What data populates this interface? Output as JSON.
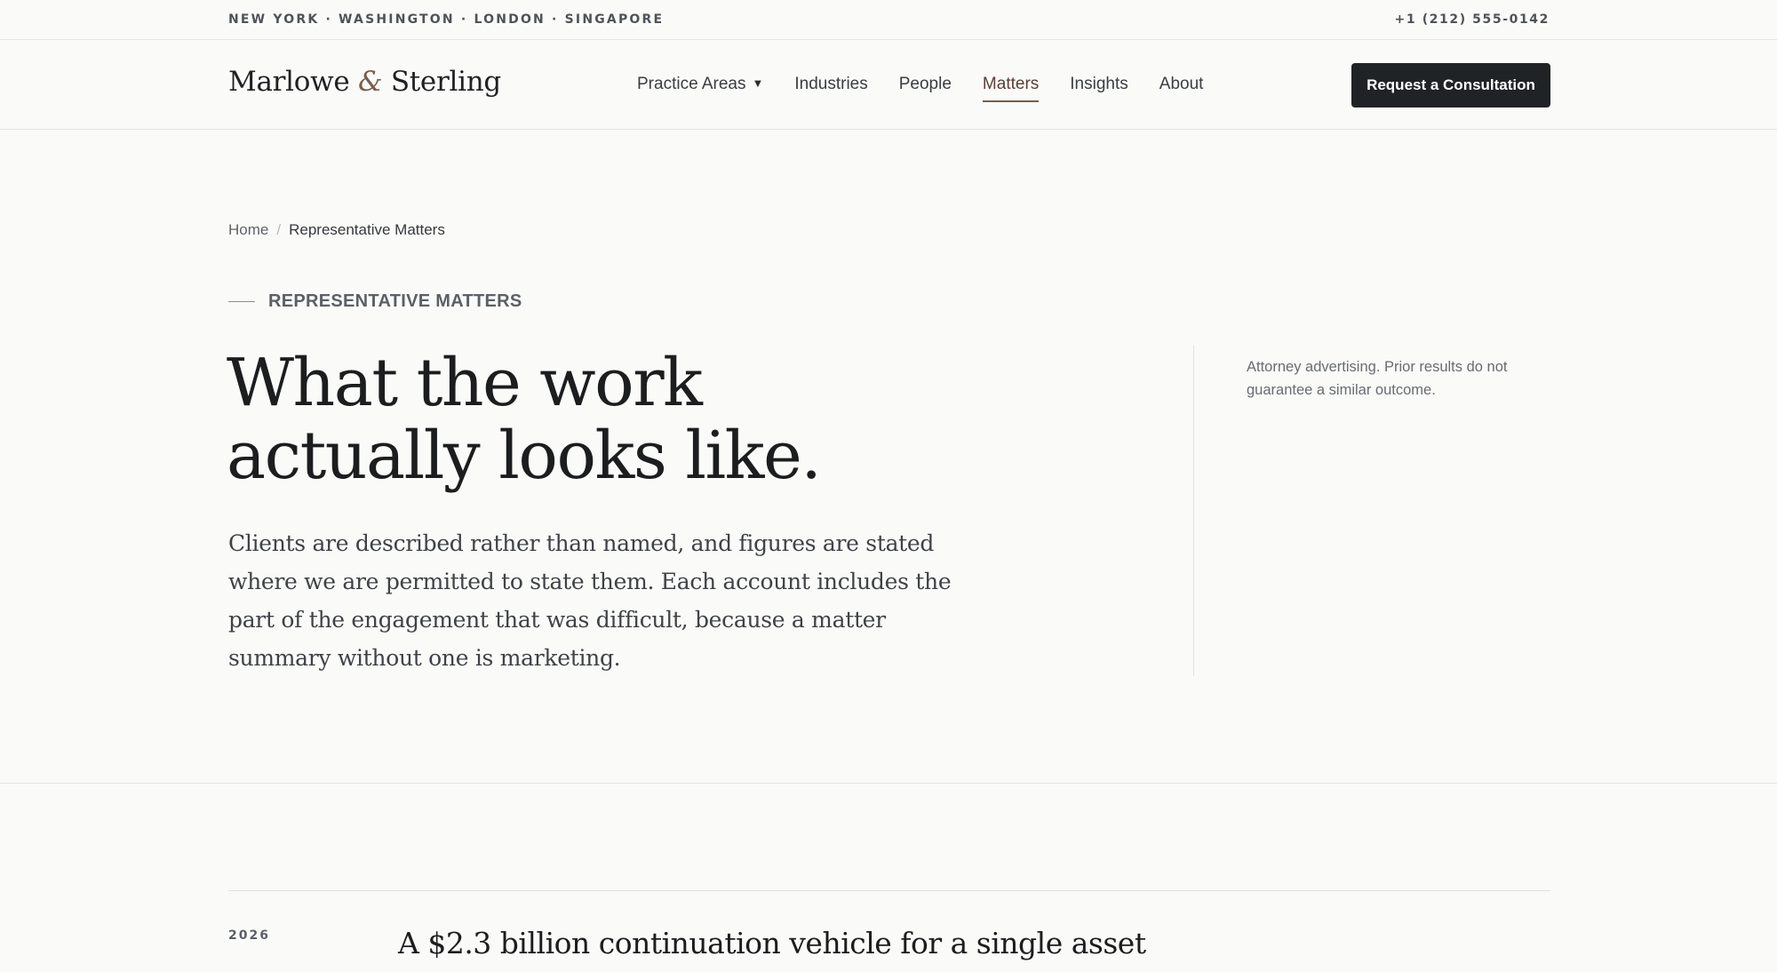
{
  "topbar": {
    "cities": "NEW YORK · WASHINGTON · LONDON · SINGAPORE",
    "phone": "+1 (212) 555-0142"
  },
  "header": {
    "logo_part1": "Marlowe",
    "logo_amp": "&",
    "logo_part2": "Sterling",
    "nav": [
      {
        "label": "Practice Areas",
        "has_caret": true
      },
      {
        "label": "Industries"
      },
      {
        "label": "People"
      },
      {
        "label": "Matters",
        "active": true
      },
      {
        "label": "Insights"
      },
      {
        "label": "About"
      }
    ],
    "caret": "▼",
    "cta_label": "Request a Consultation"
  },
  "breadcrumb": {
    "home": "Home",
    "separator": "/",
    "current": "Representative Matters"
  },
  "hero": {
    "eyebrow": "REPRESENTATIVE MATTERS",
    "title_line1": "What the work",
    "title_line2": "actually looks like.",
    "intro": "Clients are described rather than named, and figures are stated where we are permitted to state them. Each account includes the part of the engagement that was difficult, because a matter summary without one is marketing.",
    "disclaimer": "Attorney advertising. Prior results do not guarantee a similar outcome."
  },
  "matters": [
    {
      "year": "2026",
      "title": "A $2.3 billion continuation vehicle for a single asset"
    }
  ],
  "colors": {
    "accent": "#7a5d4e",
    "cta_bg": "#1f2326",
    "background": "#fafaf8"
  }
}
